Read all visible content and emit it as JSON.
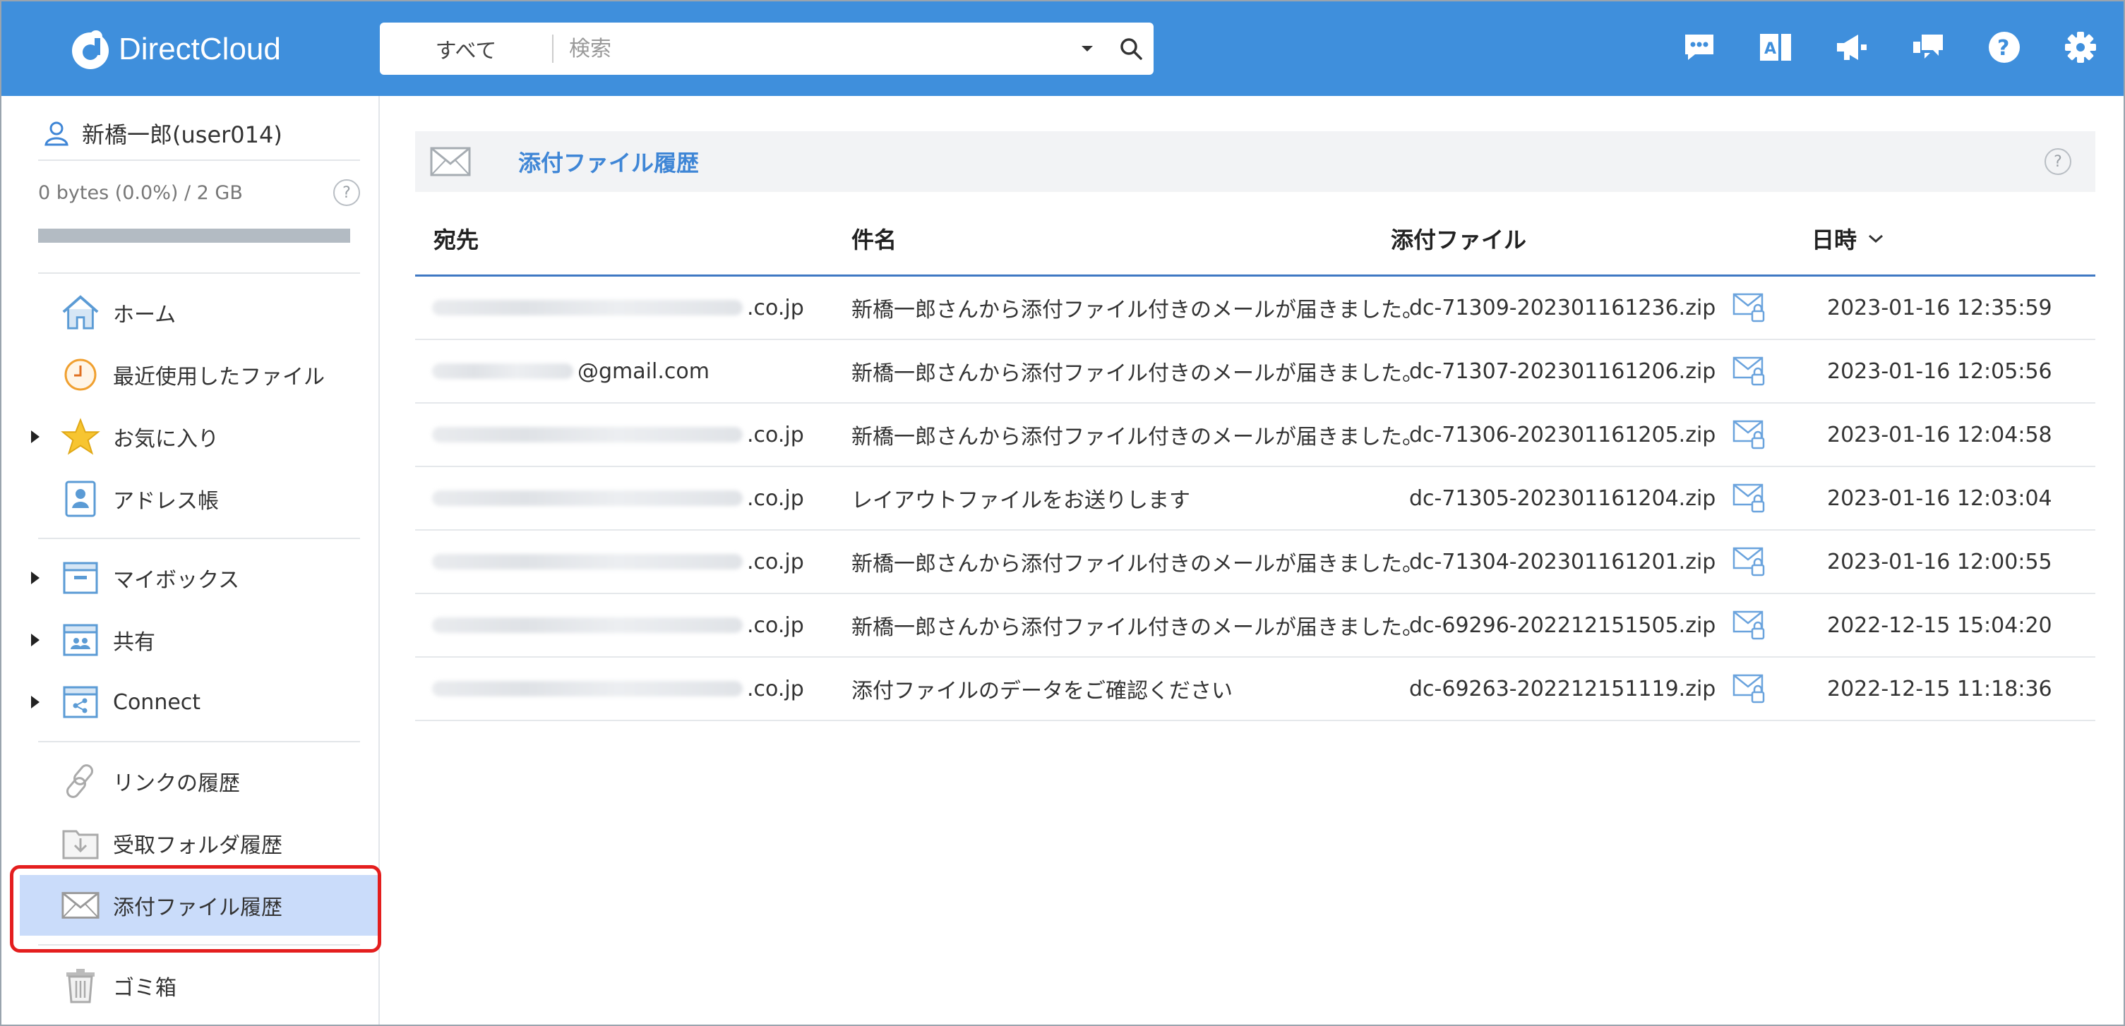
{
  "app": {
    "logo_text": "DirectCloud"
  },
  "search": {
    "scope": "すべて",
    "placeholder": "検索"
  },
  "toolbar_icons": [
    "chat-icon",
    "translate-icon",
    "announcement-icon",
    "feedback-icon",
    "help-icon",
    "settings-icon"
  ],
  "user": {
    "name": "新橋一郎(user014)",
    "quota": "0 bytes (0.0%) / 2 GB",
    "quota_used_fraction": 0.0
  },
  "sidebar": {
    "items": [
      {
        "label": "ホーム",
        "icon": "home-icon",
        "expandable": false
      },
      {
        "label": "最近使用したファイル",
        "icon": "clock-icon",
        "expandable": false
      },
      {
        "label": "お気に入り",
        "icon": "star-icon",
        "expandable": true
      },
      {
        "label": "アドレス帳",
        "icon": "address-book-icon",
        "expandable": false
      },
      {
        "label": "マイボックス",
        "icon": "mybox-icon",
        "expandable": true
      },
      {
        "label": "共有",
        "icon": "shared-icon",
        "expandable": true
      },
      {
        "label": "Connect",
        "icon": "connect-icon",
        "expandable": true
      },
      {
        "label": "リンクの履歴",
        "icon": "link-icon",
        "expandable": false
      },
      {
        "label": "受取フォルダ履歴",
        "icon": "receive-folder-icon",
        "expandable": false
      },
      {
        "label": "添付ファイル履歴",
        "icon": "mail-icon",
        "expandable": false,
        "active": true
      },
      {
        "label": "ゴミ箱",
        "icon": "trash-icon",
        "expandable": false
      }
    ]
  },
  "page": {
    "title": "添付ファイル履歴"
  },
  "table": {
    "columns": [
      "宛先",
      "件名",
      "添付ファイル",
      "日時"
    ],
    "sort_column": "日時",
    "rows": [
      {
        "to": ".co.jp",
        "subject": "新橋一郎さんから添付ファイル付きのメールが届きました。",
        "file": "dc-71309-202301161236.zip",
        "date": "2023-01-16 12:35:59"
      },
      {
        "to": "@gmail.com",
        "subject": "新橋一郎さんから添付ファイル付きのメールが届きました。",
        "file": "dc-71307-202301161206.zip",
        "date": "2023-01-16 12:05:56"
      },
      {
        "to": ".co.jp",
        "subject": "新橋一郎さんから添付ファイル付きのメールが届きました。",
        "file": "dc-71306-202301161205.zip",
        "date": "2023-01-16 12:04:58"
      },
      {
        "to": ".co.jp",
        "subject": "レイアウトファイルをお送りします",
        "file": "dc-71305-202301161204.zip",
        "date": "2023-01-16 12:03:04"
      },
      {
        "to": ".co.jp",
        "subject": "新橋一郎さんから添付ファイル付きのメールが届きました。",
        "file": "dc-71304-202301161201.zip",
        "date": "2023-01-16 12:00:55"
      },
      {
        "to": ".co.jp",
        "subject": "新橋一郎さんから添付ファイル付きのメールが届きました。",
        "file": "dc-69296-202212151505.zip",
        "date": "2022-12-15 15:04:20"
      },
      {
        "to": ".co.jp",
        "subject": "添付ファイルのデータをご確認ください",
        "file": "dc-69263-202212151119.zip",
        "date": "2022-12-15 11:18:36"
      }
    ]
  },
  "colors": {
    "topbar": "#3f8fdc",
    "accent": "#3f86d6",
    "active_bg": "#cadcfa",
    "highlight": "#e41e1e"
  }
}
